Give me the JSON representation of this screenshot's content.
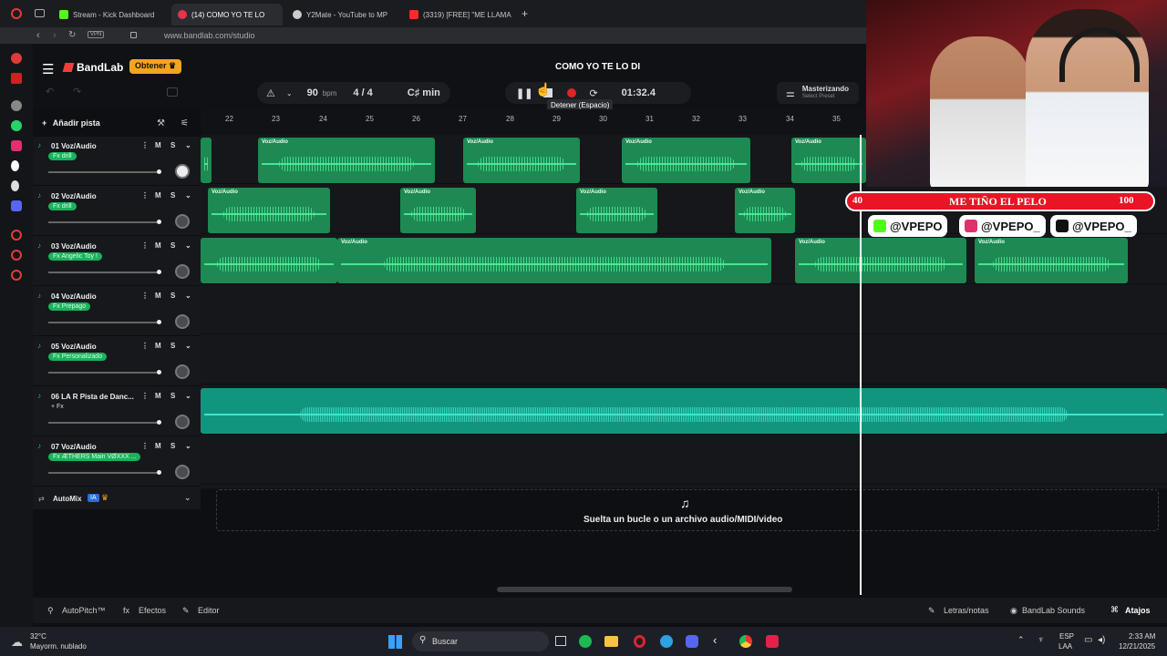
{
  "browser": {
    "tabs": [
      {
        "label": "Stream - Kick Dashboard",
        "color": "#53fc18"
      },
      {
        "label": "(14) COMO YO TE LO",
        "color": "#e9334a"
      },
      {
        "label": "Y2Mate - YouTube to MP",
        "color": "#cccccc"
      },
      {
        "label": "(3319) [FREE] \"ME LLAMA",
        "color": "#ff2b2b"
      }
    ],
    "new_tab": "+",
    "vpn": "VPN",
    "url": "www.bandlab.com/studio"
  },
  "app": {
    "logo": "BandLab",
    "upgrade": "Obtener",
    "project_title": "COMO YO TE LO DI",
    "tempo": "90",
    "tempo_unit": "bpm",
    "time_sig": "4 / 4",
    "key": "C♯ min",
    "time": "01:32.4",
    "tooltip": "Detener (Espacio)",
    "mastering_title": "Masterizando",
    "mastering_sub": "Select Preset"
  },
  "toolbar": {
    "add_track": "Añadir pista"
  },
  "ruler": [
    "22",
    "23",
    "24",
    "25",
    "26",
    "27",
    "28",
    "29",
    "30",
    "31",
    "32",
    "33",
    "34",
    "35"
  ],
  "tracks": [
    {
      "name": "01  Voz/Audio",
      "fx": "Fx drill",
      "m": "M",
      "s": "S"
    },
    {
      "name": "02  Voz/Audio",
      "fx": "Fx drill",
      "m": "M",
      "s": "S"
    },
    {
      "name": "03  Voz/Audio",
      "fx": "Fx Angelic Toy !",
      "m": "M",
      "s": "S"
    },
    {
      "name": "04  Voz/Audio",
      "fx": "Fx Prepago",
      "m": "M",
      "s": "S"
    },
    {
      "name": "05  Voz/Audio",
      "fx": "Fx Personalizado",
      "m": "M",
      "s": "S"
    },
    {
      "name": "06  LA R Pista de Danc...",
      "fx": "+ Fx",
      "m": "M",
      "s": "S"
    },
    {
      "name": "07  Voz/Audio",
      "fx": "Fx ÆTHERS Main VØXXX ...",
      "m": "M",
      "s": "S"
    }
  ],
  "clip_label": "Voz/Audio",
  "automix": {
    "label": "AutoMix",
    "badge": "IA"
  },
  "dropzone": "Suelta un bucle o un archivo audio/MIDI/video",
  "bottom": {
    "autopitch": "AutoPitch™",
    "effects": "Efectos",
    "editor": "Editor",
    "lyrics": "Letras/notas",
    "sounds": "BandLab Sounds",
    "shortcuts": "Atajos"
  },
  "overlay": {
    "left_num": "40",
    "song": "ME TIÑO EL PELO",
    "right_num": "100",
    "handles": [
      "@VPEPO",
      "@VPEPO_",
      "@VPEPO_"
    ],
    "handle_colors": [
      "#53fc18",
      "#e1306c",
      "#111111"
    ]
  },
  "taskbar": {
    "temp": "32°C",
    "weather": "Mayorm. nublado",
    "search": "Buscar",
    "lang1": "ESP",
    "lang2": "LAA",
    "clock": "2:33 AM",
    "date": "12/21/2025"
  }
}
